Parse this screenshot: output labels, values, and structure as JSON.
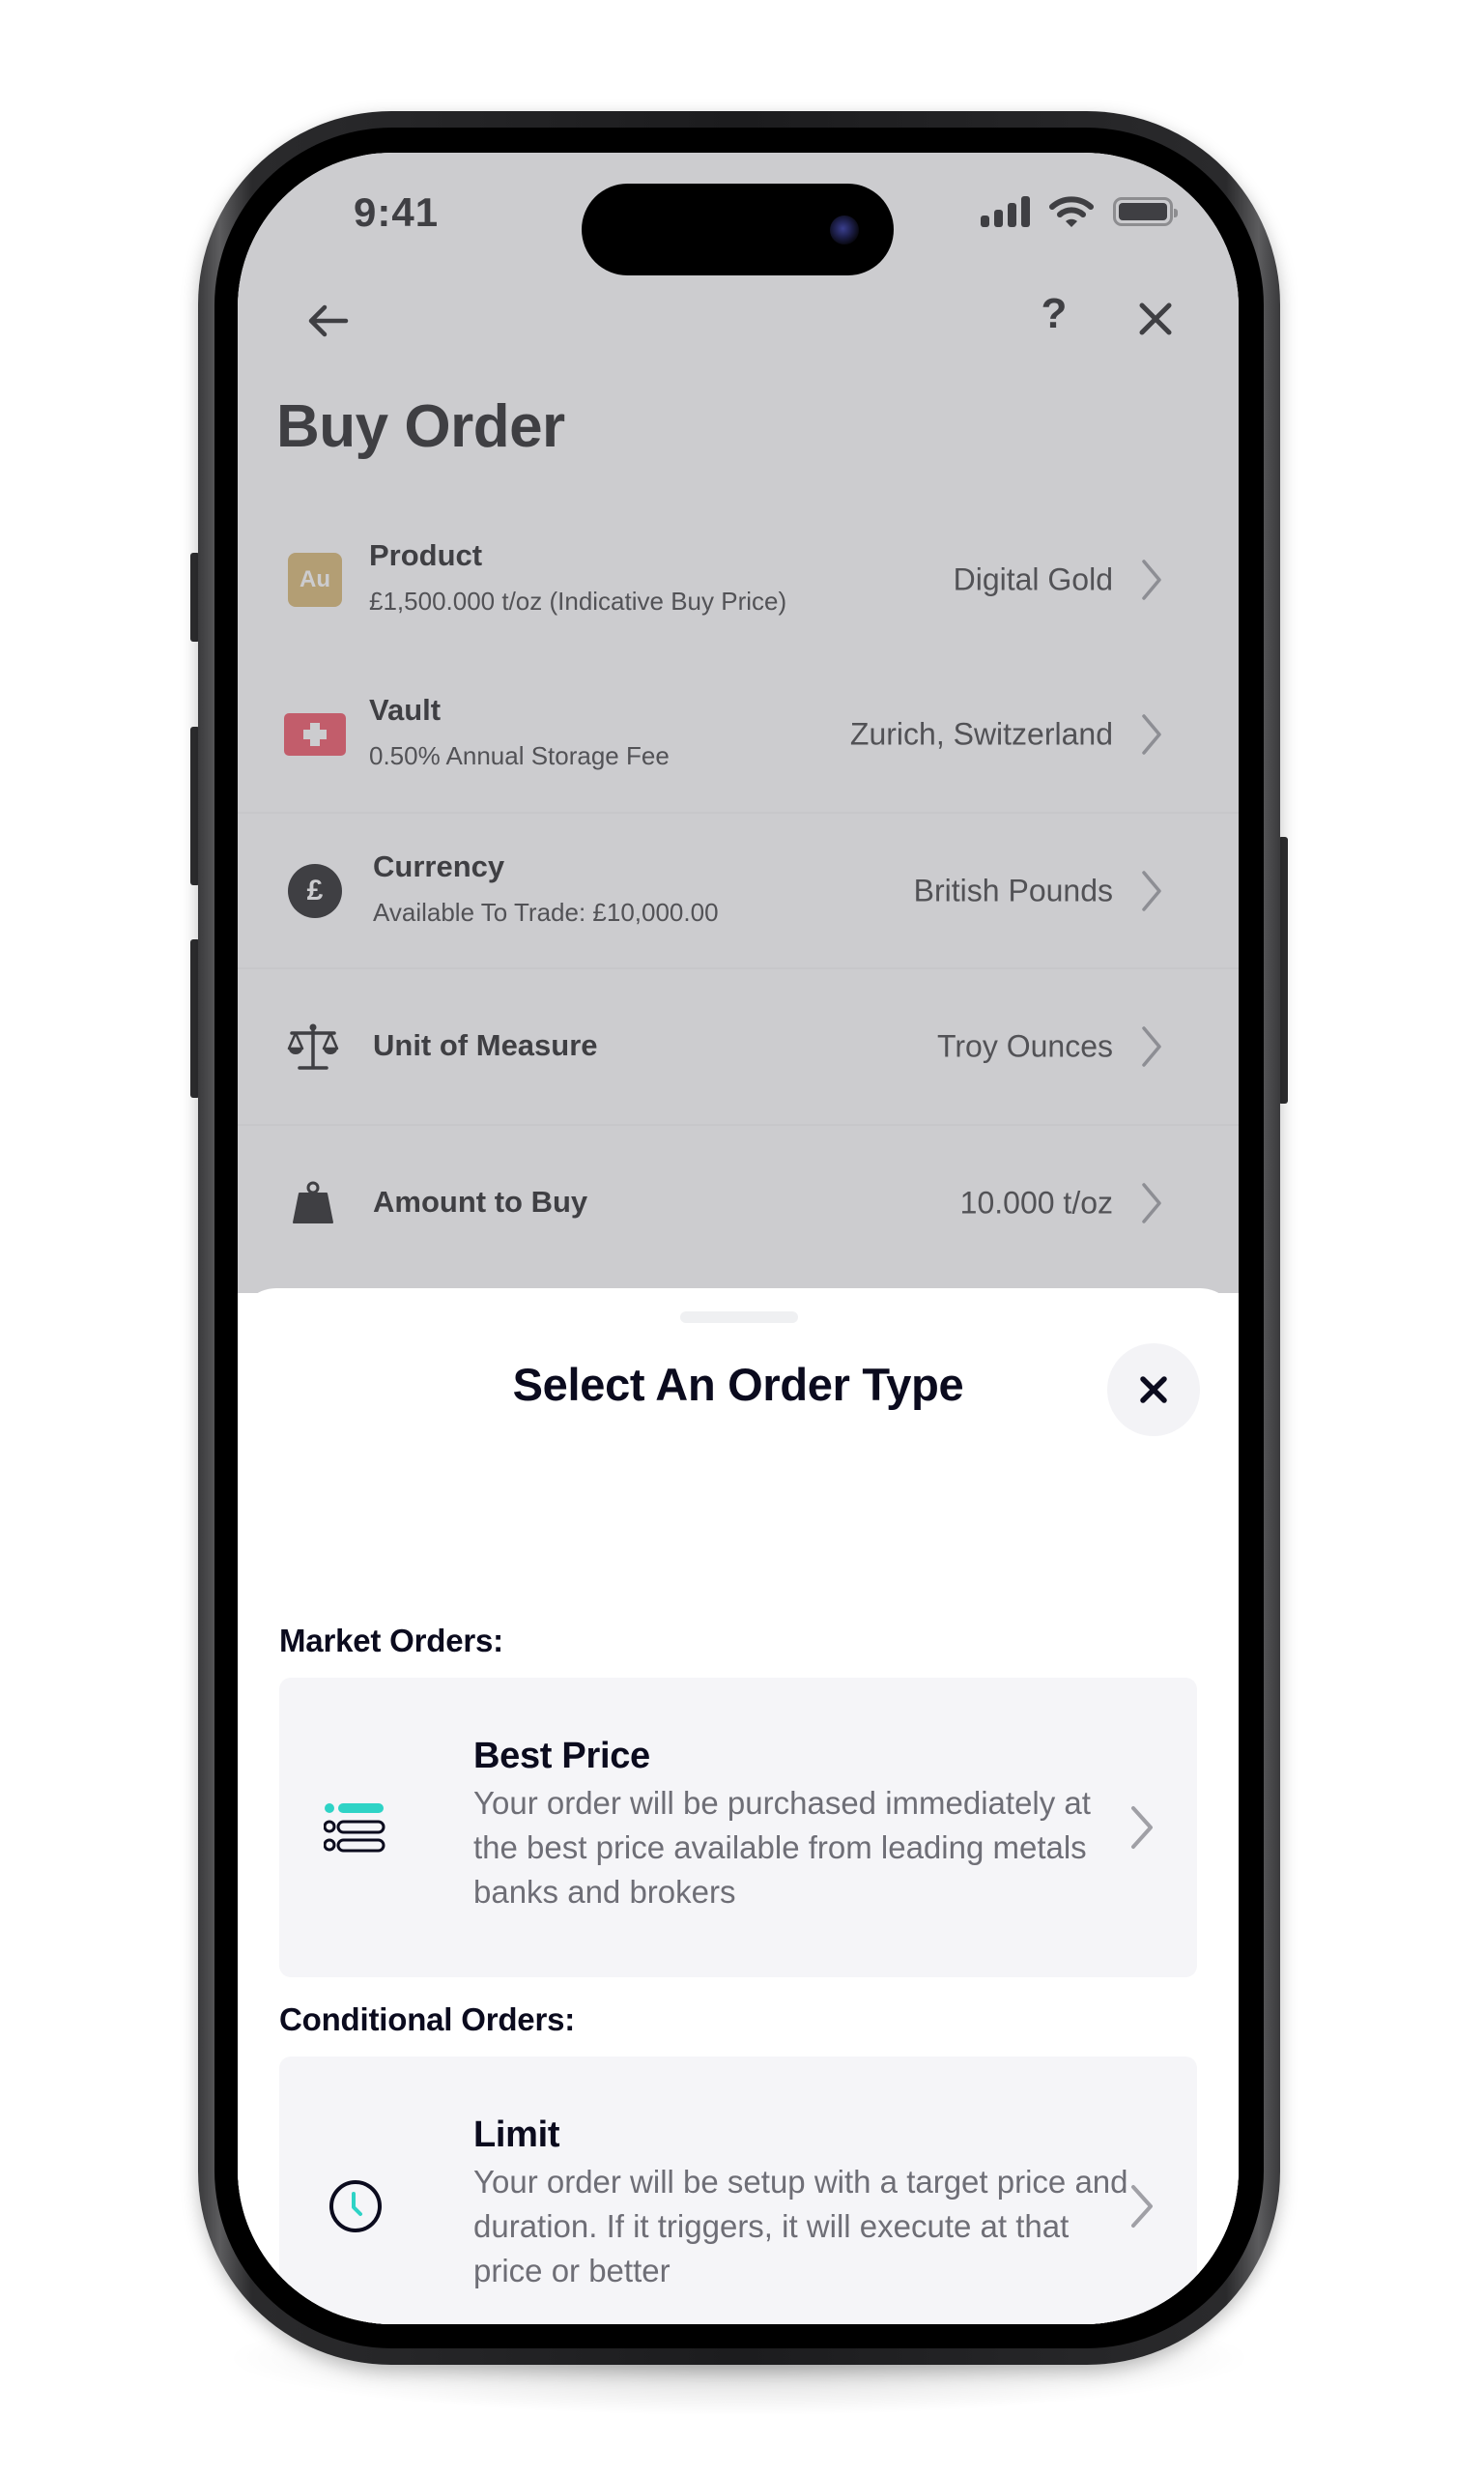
{
  "status_bar": {
    "time": "9:41",
    "icons": [
      "cellular-signal-icon",
      "wifi-icon",
      "battery-icon"
    ]
  },
  "nav": {
    "back_icon": "arrow-left-icon",
    "help_label": "?",
    "close_icon": "close-icon"
  },
  "page": {
    "title": "Buy Order",
    "rows": [
      {
        "icon": "gold-au-badge-icon",
        "icon_text": "Au",
        "title": "Product",
        "subtitle": "£1,500.000 t/oz (Indicative Buy Price)",
        "value": "Digital Gold"
      },
      {
        "icon": "swiss-flag-icon",
        "title": "Vault",
        "subtitle": "0.50% Annual Storage Fee",
        "value": "Zurich, Switzerland"
      },
      {
        "icon": "pound-coin-icon",
        "icon_text": "£",
        "title": "Currency",
        "subtitle": "Available To Trade: £10,000.00",
        "value": "British Pounds"
      },
      {
        "icon": "scales-icon",
        "title": "Unit of Measure",
        "value": "Troy Ounces"
      },
      {
        "icon": "weight-icon",
        "title": "Amount to Buy",
        "value": "10.000 t/oz"
      }
    ]
  },
  "sheet": {
    "title": "Select An Order Type",
    "close_icon": "close-icon",
    "sections": [
      {
        "label": "Market Orders:",
        "options": [
          {
            "icon": "list-options-icon",
            "title": "Best Price",
            "description": "Your order will be purchased immediately at the best price available from leading metals banks and brokers"
          }
        ]
      },
      {
        "label": "Conditional Orders:",
        "options": [
          {
            "icon": "clock-icon",
            "title": "Limit",
            "description": "Your order will be setup with a target price and duration. If it triggers, it will execute at that price or better"
          }
        ]
      }
    ]
  },
  "colors": {
    "accent": "#2ED3C6",
    "text_dark": "#0B0B1E",
    "text_muted": "#6E6E76",
    "card_bg": "#F5F5F8",
    "gold": "#D7B56D",
    "swiss_red": "#EF4D5E",
    "overlay": "#CBCCD0"
  }
}
